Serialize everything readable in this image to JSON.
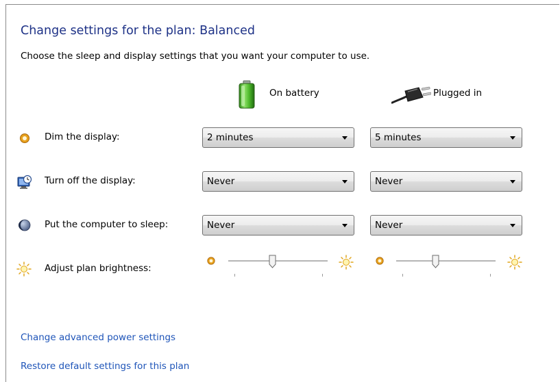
{
  "header": {
    "title": "Change settings for the plan: Balanced",
    "subtitle": "Choose the sleep and display settings that you want your computer to use."
  },
  "columns": {
    "battery_label": "On battery",
    "battery_icon": "battery-icon",
    "plugged_label": "Plugged in",
    "plugged_icon": "power-plug-icon"
  },
  "settings": [
    {
      "label": "Dim the display:",
      "icon": "dim-display-icon",
      "on_battery": "2 minutes",
      "plugged_in": "5 minutes"
    },
    {
      "label": "Turn off the display:",
      "icon": "monitor-clock-icon",
      "on_battery": "Never",
      "plugged_in": "Never"
    },
    {
      "label": "Put the computer to sleep:",
      "icon": "moon-sleep-icon",
      "on_battery": "Never",
      "plugged_in": "Never"
    }
  ],
  "brightness": {
    "label": "Adjust plan brightness:",
    "icon": "sun-brightness-icon",
    "on_battery_level": 0.45,
    "plugged_in_level": 0.4
  },
  "links": {
    "advanced": "Change advanced power settings",
    "restore": "Restore default settings for this plan"
  },
  "colors": {
    "title": "#1e3287",
    "link": "#1e54b8"
  }
}
